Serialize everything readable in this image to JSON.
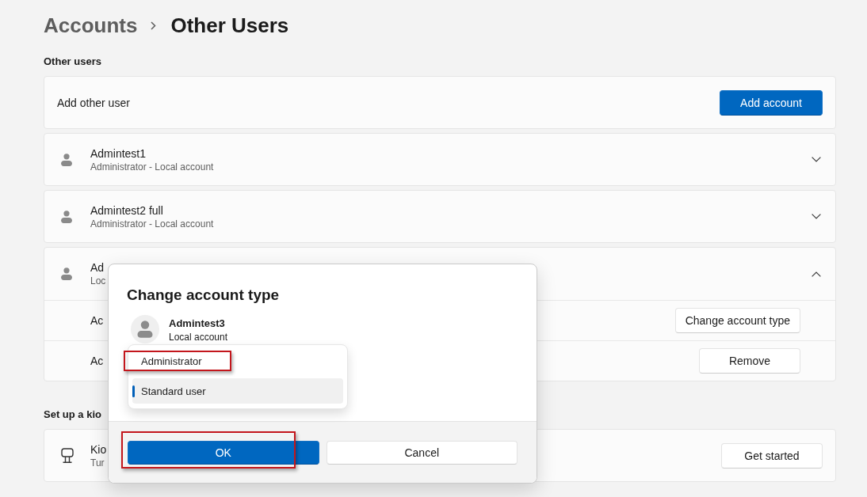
{
  "breadcrumb": {
    "parent": "Accounts",
    "current": "Other Users"
  },
  "other_users": {
    "heading": "Other users",
    "add_user": {
      "label": "Add other user",
      "button": "Add account"
    },
    "accounts": [
      {
        "name": "Admintest1",
        "subtitle": "Administrator - Local account",
        "expanded": false
      },
      {
        "name": "Admintest2 full",
        "subtitle": "Administrator - Local account",
        "expanded": false
      },
      {
        "name": "Ad",
        "subtitle": "Loc",
        "expanded": true,
        "options": [
          {
            "label": "Ac",
            "button": "Change account type"
          },
          {
            "label": "Ac",
            "button": "Remove"
          }
        ]
      }
    ]
  },
  "kiosk": {
    "heading": "Set up a kio",
    "title": "Kio",
    "subtitle": "Tur",
    "button": "Get started"
  },
  "dialog": {
    "title": "Change account type",
    "user": {
      "name": "Admintest3",
      "subtitle": "Local account"
    },
    "account_type_menu": [
      {
        "label": "Administrator",
        "selected": false,
        "highlighted": true
      },
      {
        "label": "Standard user",
        "selected": true,
        "highlighted": false
      }
    ],
    "buttons": [
      {
        "label": "OK",
        "kind": "primary",
        "highlighted": true
      },
      {
        "label": "Cancel",
        "kind": "secondary",
        "highlighted": false
      }
    ]
  }
}
